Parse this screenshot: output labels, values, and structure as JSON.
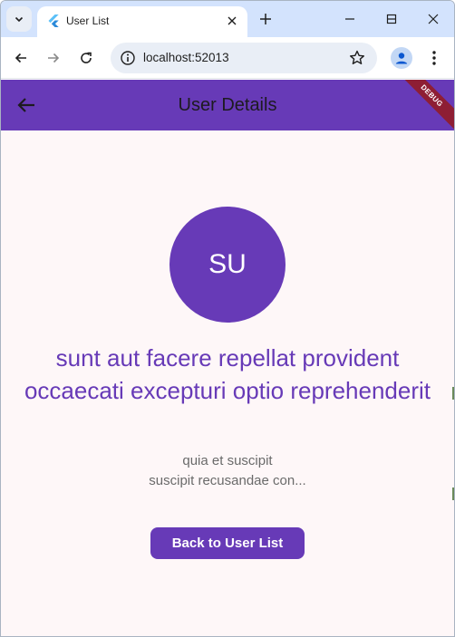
{
  "browser": {
    "tab": {
      "title": "User List",
      "favicon": "flutter-icon"
    },
    "new_tab_glyph": "+",
    "address": {
      "url": "localhost:52013"
    },
    "icons": [
      "tab-search-icon",
      "close-icon",
      "minimize-icon",
      "maximize-icon",
      "window-close-icon",
      "back-icon",
      "forward-icon",
      "reload-icon",
      "info-icon",
      "star-icon",
      "profile-icon",
      "more-icon"
    ]
  },
  "app": {
    "appbar": {
      "title": "User Details",
      "debug_banner": "DEBUG"
    },
    "avatar": {
      "initials": "SU"
    },
    "post": {
      "title": "sunt aut facere repellat provident occaecati excepturi optio reprehenderit",
      "body_line1": "quia et suscipit",
      "body_line2": "suscipit recusandae con..."
    },
    "back_button": {
      "label": "Back to User List"
    }
  },
  "colors": {
    "primary": "#673ab7",
    "background": "#fef7f8",
    "debug": "#8e1e34",
    "tabstrip": "#d3e3fd"
  }
}
